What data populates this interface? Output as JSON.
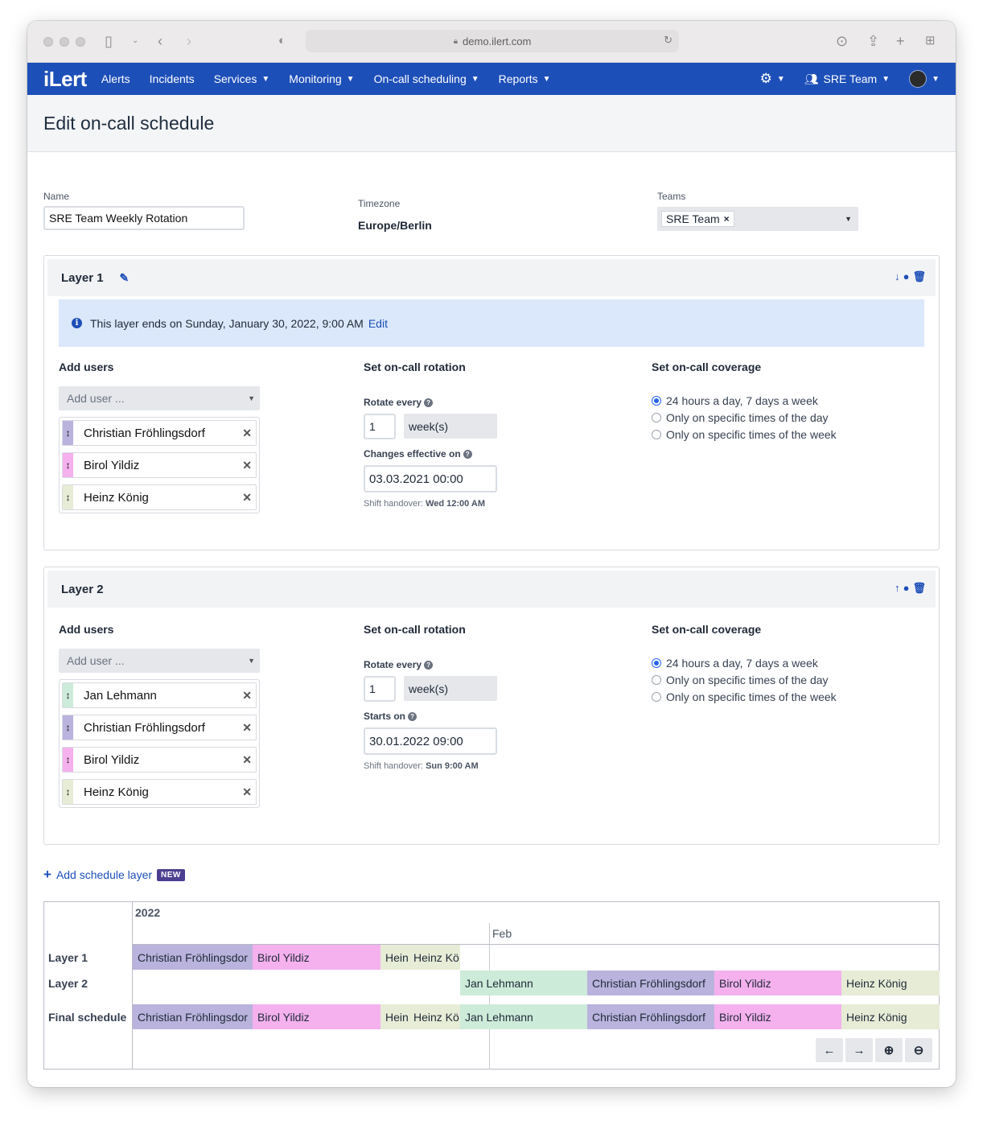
{
  "browser": {
    "url": "demo.ilert.com"
  },
  "nav": {
    "logo": "iLert",
    "items": [
      {
        "label": "Alerts",
        "dropdown": false
      },
      {
        "label": "Incidents",
        "dropdown": false
      },
      {
        "label": "Services",
        "dropdown": true
      },
      {
        "label": "Monitoring",
        "dropdown": true
      },
      {
        "label": "On-call scheduling",
        "dropdown": true
      },
      {
        "label": "Reports",
        "dropdown": true
      }
    ],
    "team": "SRE Team"
  },
  "page": {
    "title": "Edit on-call schedule"
  },
  "form": {
    "name_label": "Name",
    "name_value": "SRE Team Weekly Rotation",
    "timezone_label": "Timezone",
    "timezone_value": "Europe/Berlin",
    "teams_label": "Teams",
    "teams_tag": "SRE Team",
    "teams_tag_remove": "×"
  },
  "layers": [
    {
      "title": "Layer 1",
      "info": "This layer ends on Sunday, January 30, 2022, 9:00 AM",
      "info_edit": "Edit",
      "add_users_title": "Add users",
      "add_user_placeholder": "Add user ...",
      "users": [
        {
          "name": "Christian Fröhlingsdorf",
          "color": "#b9b3dd"
        },
        {
          "name": "Birol Yildiz",
          "color": "#f4b1ee"
        },
        {
          "name": "Heinz König",
          "color": "#e7ecd6"
        }
      ],
      "rotation_title": "Set on-call rotation",
      "rotate_label": "Rotate every",
      "rotate_value": "1",
      "rotate_unit": "week(s)",
      "date_label": "Changes effective on",
      "date_value": "03.03.2021 00:00",
      "handover_prefix": "Shift handover:",
      "handover_value": "Wed 12:00 AM",
      "coverage_title": "Set on-call coverage",
      "coverage_options": [
        "24 hours a day, 7 days a week",
        "Only on specific times of the day",
        "Only on specific times of the week"
      ],
      "coverage_selected": 0
    },
    {
      "title": "Layer 2",
      "add_users_title": "Add users",
      "add_user_placeholder": "Add user ...",
      "users": [
        {
          "name": "Jan Lehmann",
          "color": "#cdebd9"
        },
        {
          "name": "Christian Fröhlingsdorf",
          "color": "#b9b3dd"
        },
        {
          "name": "Birol Yildiz",
          "color": "#f4b1ee"
        },
        {
          "name": "Heinz König",
          "color": "#e7ecd6"
        }
      ],
      "rotation_title": "Set on-call rotation",
      "rotate_label": "Rotate every",
      "rotate_value": "1",
      "rotate_unit": "week(s)",
      "date_label": "Starts on",
      "date_value": "30.01.2022 09:00",
      "handover_prefix": "Shift handover:",
      "handover_value": "Sun 9:00 AM",
      "coverage_title": "Set on-call coverage",
      "coverage_options": [
        "24 hours a day, 7 days a week",
        "Only on specific times of the day",
        "Only on specific times of the week"
      ],
      "coverage_selected": 0
    }
  ],
  "add_layer": {
    "label": "Add schedule layer",
    "badge": "NEW"
  },
  "timeline": {
    "year": "2022",
    "month": "Feb",
    "rows": [
      "Layer 1",
      "Layer 2",
      "Final schedule"
    ],
    "layer1": [
      {
        "name": "Christian Fröhlingsdor",
        "color": "#b9b3dd"
      },
      {
        "name": "Birol Yildiz",
        "color": "#f4b1ee"
      },
      {
        "name": "Hein",
        "color": "#e7ecd6"
      },
      {
        "name": "Heinz Kö",
        "color": "#e7ecd6"
      }
    ],
    "layer2": [
      {
        "name": "Jan Lehmann",
        "color": "#cdebd9"
      },
      {
        "name": "Christian Fröhlingsdorf",
        "color": "#b9b3dd"
      },
      {
        "name": "Birol Yildiz",
        "color": "#f4b1ee"
      },
      {
        "name": "Heinz König",
        "color": "#e7ecd6"
      }
    ],
    "final": [
      {
        "name": "Christian Fröhlingsdor",
        "color": "#b9b3dd"
      },
      {
        "name": "Birol Yildiz",
        "color": "#f4b1ee"
      },
      {
        "name": "Hein",
        "color": "#e7ecd6"
      },
      {
        "name": "Heinz Kö",
        "color": "#e7ecd6"
      },
      {
        "name": "Jan Lehmann",
        "color": "#cdebd9"
      },
      {
        "name": "Christian Fröhlingsdorf",
        "color": "#b9b3dd"
      },
      {
        "name": "Birol Yildiz",
        "color": "#f4b1ee"
      },
      {
        "name": "Heinz König",
        "color": "#e7ecd6"
      }
    ],
    "buttons": [
      "←",
      "→",
      "⊕",
      "⊖"
    ]
  }
}
